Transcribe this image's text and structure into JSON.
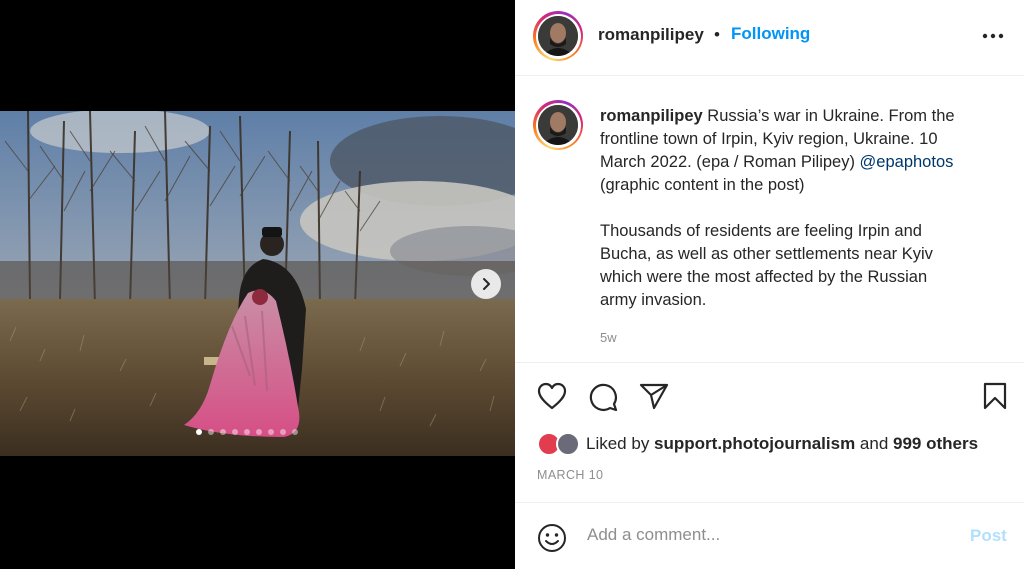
{
  "post": {
    "username": "romanpilipey",
    "separator": "•",
    "follow_label": "Following",
    "caption_lines": [
      "Russia’s war in Ukraine. From the",
      "frontline town of Irpin, Kyiv region, Ukraine. 10",
      "March 2022. (epa / Roman Pilipey) "
    ],
    "mention": "@epaphotos",
    "caption_line4": "(graphic content in the post)",
    "caption_para2": [
      "Thousands of residents are feeling Irpin and",
      "Bucha, as well as other settlements near Kyiv",
      "which were the most affected by the Russian",
      "army invasion."
    ],
    "age": "5w"
  },
  "carousel": {
    "slide_count": 9,
    "active_index": 0
  },
  "likes": {
    "prefix": "Liked by ",
    "user": "support.photojournalism",
    "middle": " and ",
    "others": "999 others"
  },
  "date": "MARCH 10",
  "comment": {
    "placeholder": "Add a comment...",
    "post_label": "Post"
  },
  "icons": {
    "more": "more-horizontal-icon",
    "like": "heart-icon",
    "comment": "comment-icon",
    "share": "paper-plane-icon",
    "save": "bookmark-icon",
    "next": "chevron-right-icon",
    "emoji": "smiley-icon"
  },
  "colors": {
    "accent": "#0095f6",
    "mention": "#00376b",
    "post_disabled": "#b2dffc",
    "muted": "#8e8e8e"
  }
}
